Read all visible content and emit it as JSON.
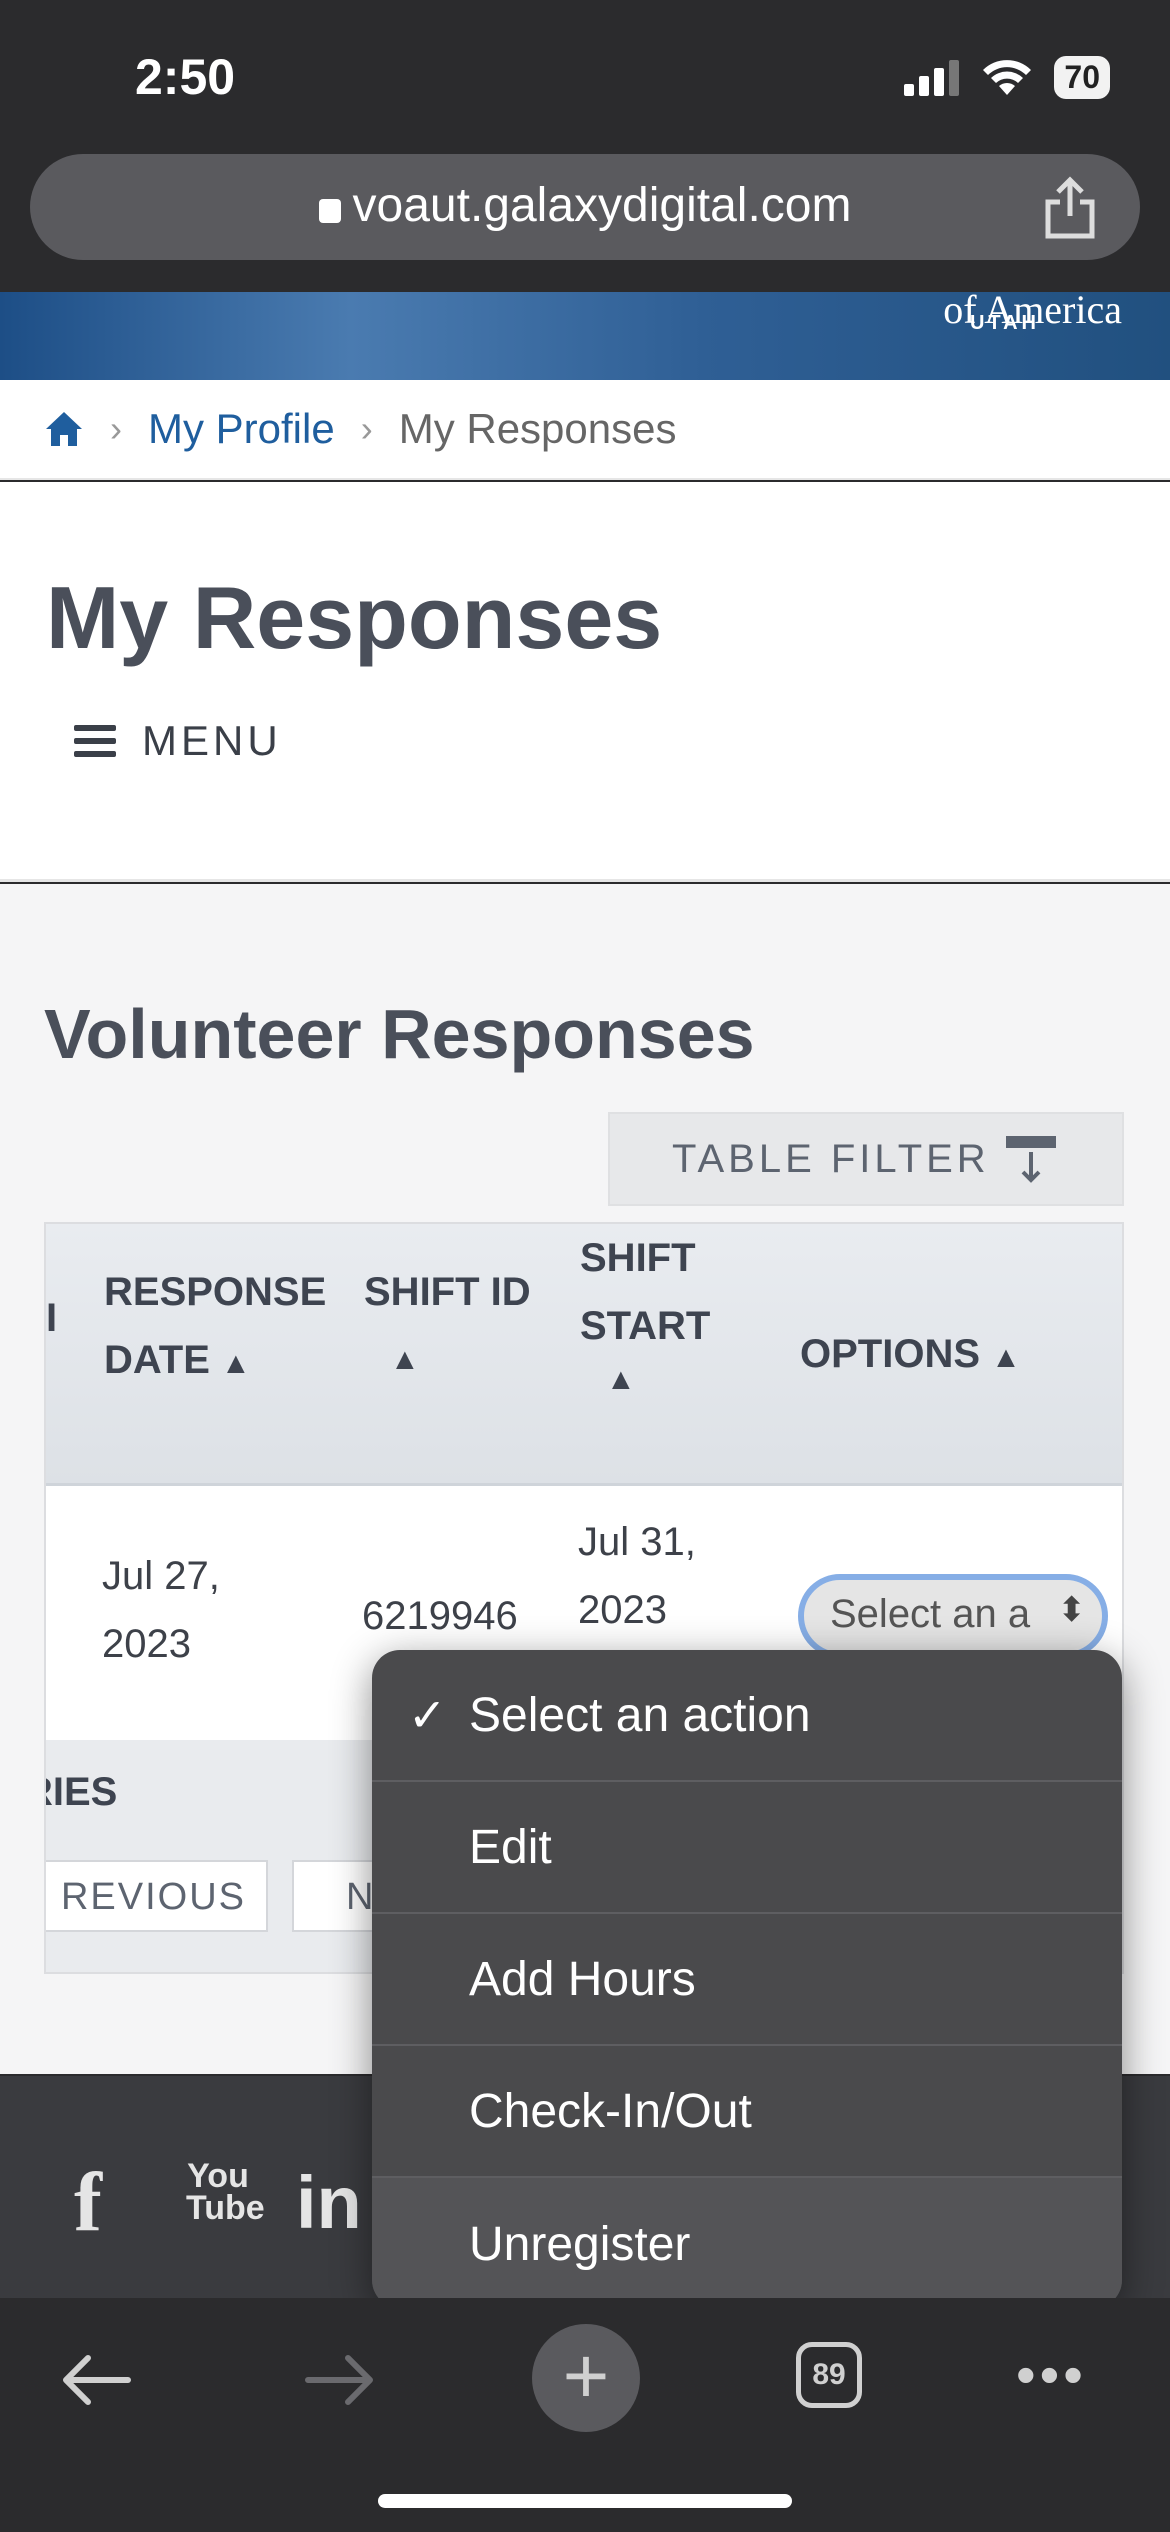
{
  "status_bar": {
    "time": "2:50",
    "battery": "70"
  },
  "browser": {
    "url": "voaut.galaxydigital.com",
    "tabs_count": "89"
  },
  "banner": {
    "text": "of America",
    "subtext": "UTAH"
  },
  "breadcrumb": {
    "items": [
      "My Profile",
      "My Responses"
    ]
  },
  "page": {
    "title": "My Responses",
    "menu_label": "MENU"
  },
  "section": {
    "title": "Volunteer Responses",
    "filter_label": "TABLE FILTER"
  },
  "table": {
    "headers": [
      "I",
      "RESPONSE DATE",
      "SHIFT ID",
      "SHIFT START",
      "OPTIONS"
    ],
    "header_lines": {
      "response_date": [
        "RESPONSE",
        "DATE"
      ],
      "shift_start": [
        "SHIFT",
        "START"
      ]
    },
    "row": {
      "response_date": [
        "Jul 27,",
        "2023"
      ],
      "shift_id": "6219946",
      "shift_start": [
        "Jul 31,",
        "2023"
      ],
      "options_value": "Select an a"
    },
    "footer": {
      "entries": "RIES",
      "previous": "REVIOUS",
      "next": "N"
    }
  },
  "dropdown": {
    "options": [
      "Select an action",
      "Edit",
      "Add Hours",
      "Check-In/Out",
      "Unregister"
    ],
    "selected": "Select an action"
  },
  "footer": {
    "social": [
      "f",
      "You Tube",
      "in"
    ]
  }
}
